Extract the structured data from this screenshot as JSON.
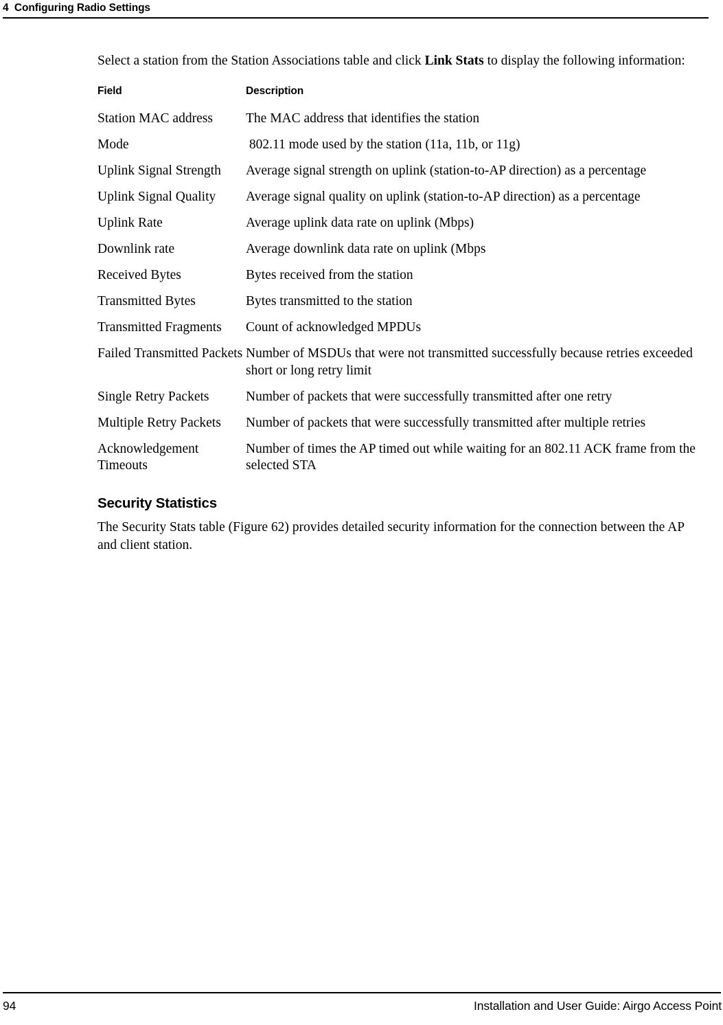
{
  "header": {
    "chapter_number": "4",
    "chapter_title": "Configuring Radio Settings",
    "full_text": "4  Configuring Radio Settings"
  },
  "intro": {
    "text_before_bold": "Select a station from the Station Associations table and click ",
    "bold_text": "Link Stats",
    "text_after_bold": " to display the following information:"
  },
  "link_stats_table": {
    "columns": [
      "Field",
      "Description"
    ],
    "rows": [
      {
        "field": "Station MAC address",
        "description": "The MAC address that identifies the station"
      },
      {
        "field": "Mode",
        "description": " 802.11 mode used by the station (11a, 11b, or 11g)"
      },
      {
        "field": "Uplink Signal Strength",
        "description": "Average signal strength on uplink (station-to-AP direction) as a percentage"
      },
      {
        "field": "Uplink Signal Quality",
        "description": "Average signal quality on uplink (station-to-AP direction) as a percentage"
      },
      {
        "field": "Uplink Rate",
        "description": "Average uplink data rate on uplink (Mbps)"
      },
      {
        "field": "Downlink rate",
        "description": "Average downlink data rate on uplink (Mbps"
      },
      {
        "field": "Received Bytes",
        "description": "Bytes received from the station"
      },
      {
        "field": "Transmitted Bytes",
        "description": "Bytes transmitted to the station"
      },
      {
        "field": "Transmitted Fragments",
        "description": "Count of acknowledged MPDUs"
      },
      {
        "field": "Failed Transmitted Packets",
        "description": "Number of MSDUs that were not transmitted successfully because retries exceeded short or long retry limit"
      },
      {
        "field": "Single Retry Packets",
        "description": "Number of packets that were successfully transmitted after one retry"
      },
      {
        "field": "Multiple Retry Packets",
        "description": "Number of packets that were successfully transmitted after multiple retries"
      },
      {
        "field": "Acknowledgement Timeouts",
        "description": "Number of times the AP timed out while waiting for an 802.11 ACK frame from the selected STA"
      }
    ]
  },
  "security_section": {
    "heading": "Security Statistics",
    "paragraph": "The Security Stats table (Figure 62) provides detailed security information for the connection between the AP and client station."
  },
  "footer": {
    "page_number": "94",
    "guide_title": "Installation and User Guide: Airgo Access Point"
  }
}
